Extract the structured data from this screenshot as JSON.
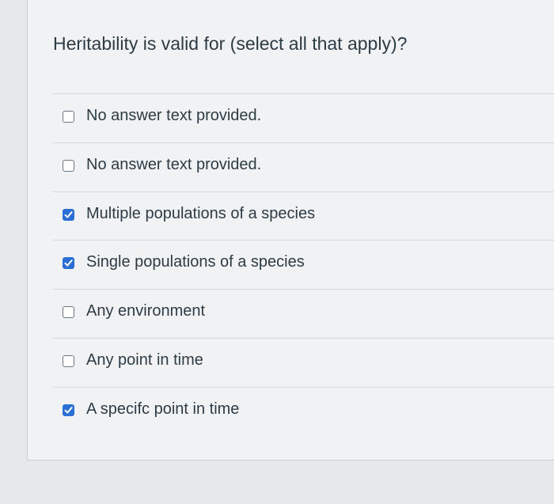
{
  "question": {
    "text": "Heritability is valid for (select all that apply)?"
  },
  "answers": [
    {
      "label": "No answer text provided.",
      "checked": false
    },
    {
      "label": "No answer text provided.",
      "checked": false
    },
    {
      "label": "Multiple populations of a species",
      "checked": true
    },
    {
      "label": "Single populations of a species",
      "checked": true
    },
    {
      "label": "Any environment",
      "checked": false
    },
    {
      "label": "Any point in time",
      "checked": false
    },
    {
      "label": "A specifc point in time",
      "checked": true
    }
  ],
  "colors": {
    "checked": "#2b6fd6",
    "text": "#2d3b45"
  }
}
